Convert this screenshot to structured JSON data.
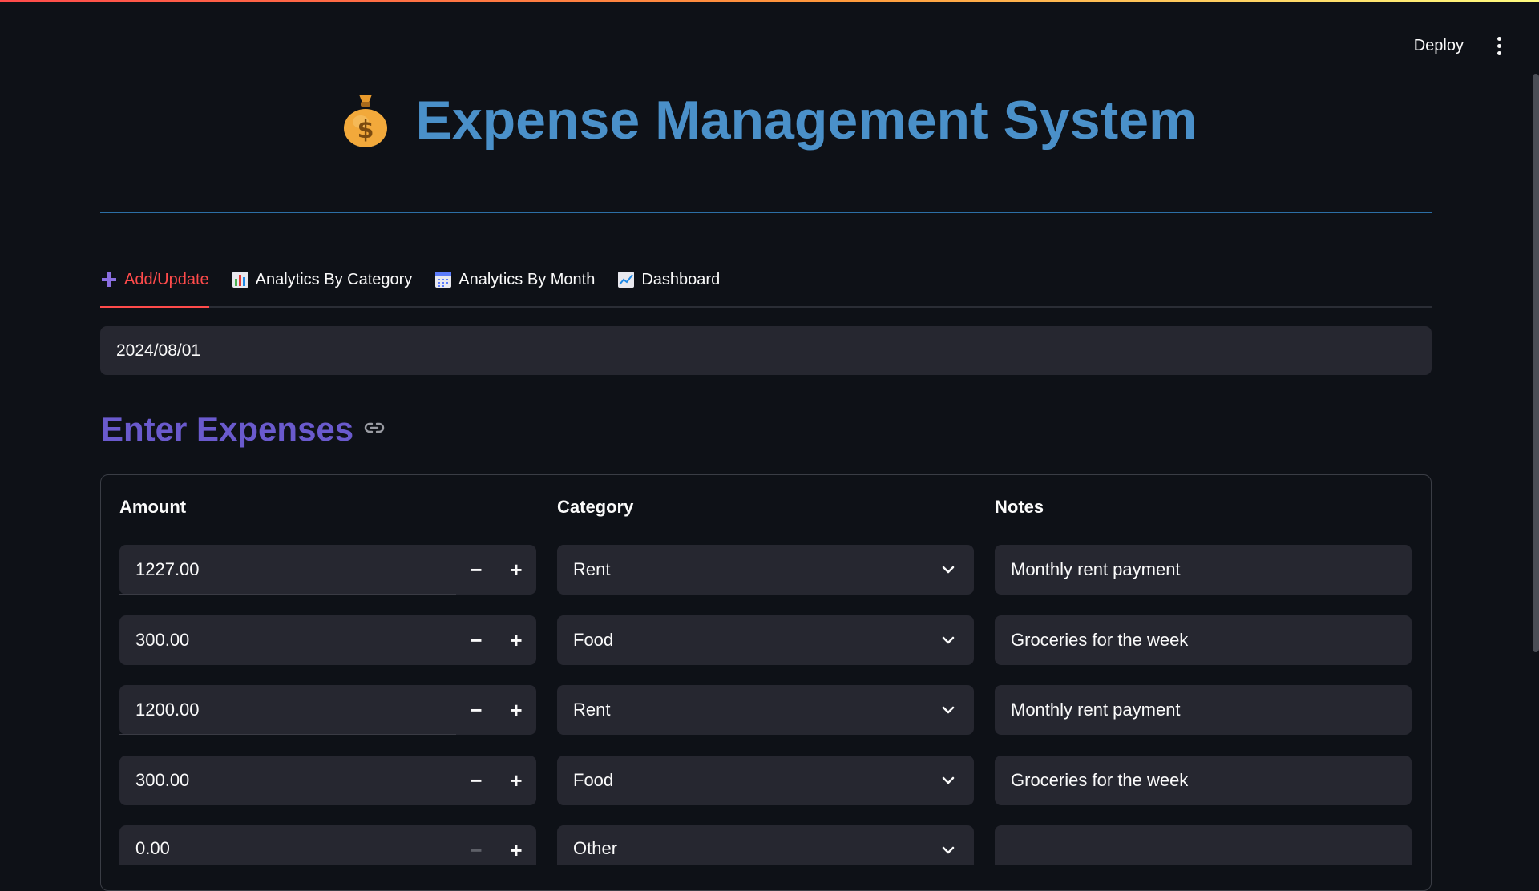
{
  "header": {
    "deploy_label": "Deploy"
  },
  "title": {
    "text": "Expense Management System",
    "icon": "money-bag-icon"
  },
  "tabs": [
    {
      "label": "Add/Update",
      "icon": "plus-icon",
      "active": true
    },
    {
      "label": "Analytics By Category",
      "icon": "bar-chart-icon",
      "active": false
    },
    {
      "label": "Analytics By Month",
      "icon": "calendar-icon",
      "active": false
    },
    {
      "label": "Dashboard",
      "icon": "line-chart-icon",
      "active": false
    }
  ],
  "date_input": {
    "value": "2024/08/01"
  },
  "section": {
    "heading": "Enter Expenses",
    "anchor_icon": "link-icon"
  },
  "table": {
    "headers": {
      "amount": "Amount",
      "category": "Category",
      "notes": "Notes"
    },
    "rows": [
      {
        "amount": "1227.00",
        "category": "Rent",
        "notes": "Monthly rent payment"
      },
      {
        "amount": "300.00",
        "category": "Food",
        "notes": "Groceries for the week"
      },
      {
        "amount": "1200.00",
        "category": "Rent",
        "notes": "Monthly rent payment"
      },
      {
        "amount": "300.00",
        "category": "Food",
        "notes": "Groceries for the week"
      },
      {
        "amount": "0.00",
        "category": "Other",
        "notes": ""
      }
    ]
  },
  "colors": {
    "accent_red": "#ff4b4b",
    "title_blue": "#4a90c9",
    "heading_purple": "#6a5acd",
    "background": "#0e1117",
    "field_bg": "#262730"
  }
}
